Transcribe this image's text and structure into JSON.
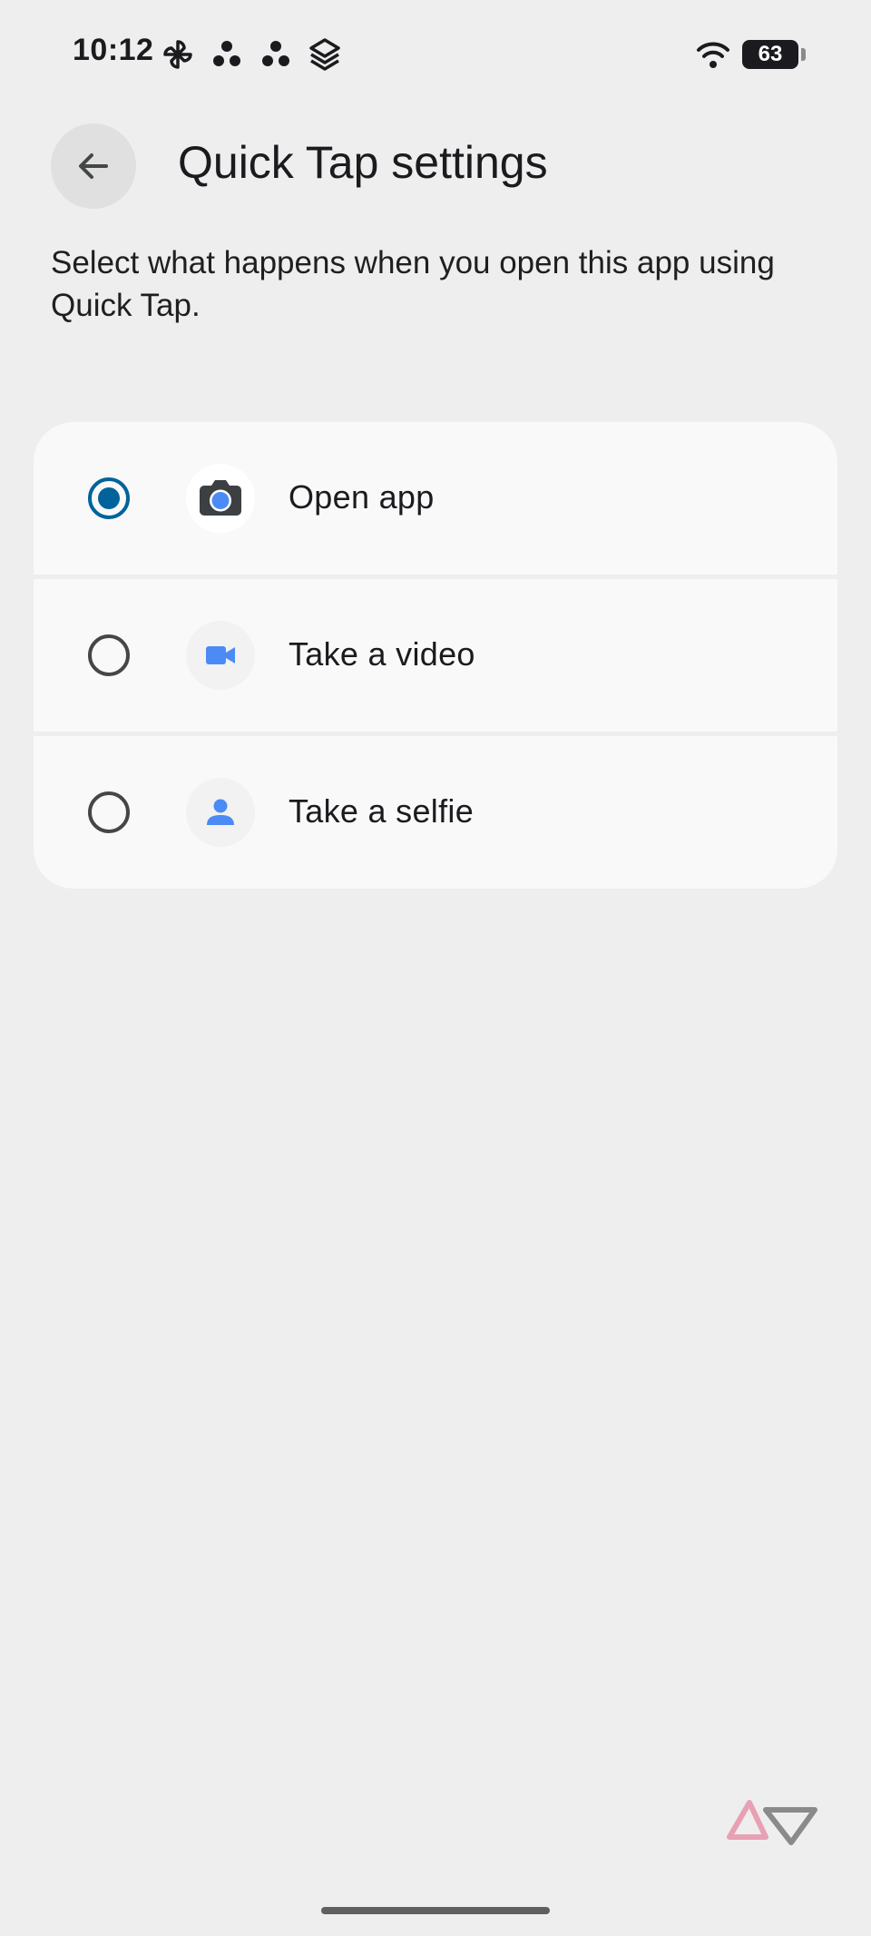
{
  "status_bar": {
    "time": "10:12",
    "left_icons": [
      "pinwheel-icon",
      "dots-icon",
      "dots-icon",
      "layers-icon"
    ],
    "right_icons": [
      "wifi-icon",
      "battery-icon"
    ],
    "battery_level": "63"
  },
  "header": {
    "back_icon": "arrow-back-icon",
    "title": "Quick Tap settings"
  },
  "description": "Select what happens when you open this app using Quick Tap.",
  "options": [
    {
      "label": "Open app",
      "icon": "camera-icon",
      "selected": true
    },
    {
      "label": "Take a video",
      "icon": "videocam-icon",
      "selected": false
    },
    {
      "label": "Take a selfie",
      "icon": "person-icon",
      "selected": false
    }
  ],
  "colors": {
    "background": "#eeeeee",
    "card": "#f9f9f9",
    "radio_selected": "#00639b",
    "icon_blue": "#4c8bf5",
    "watermark_pink": "#e8a0b4",
    "watermark_grey": "#8a8a8a"
  }
}
